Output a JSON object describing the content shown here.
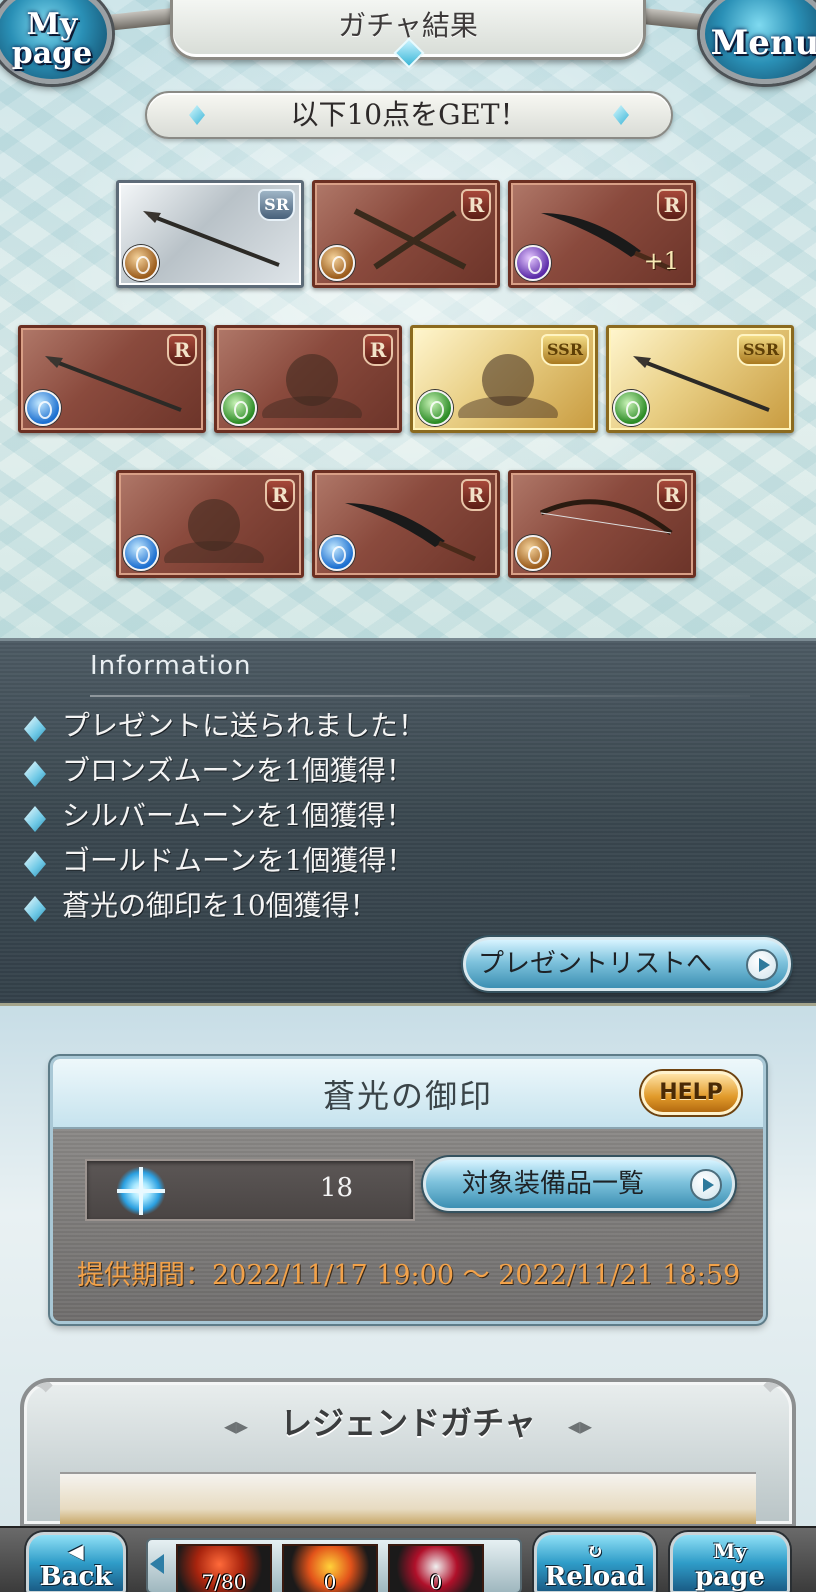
{
  "header": {
    "title": "ガチャ結果",
    "mypage_button": {
      "line1": "My",
      "line2": "page"
    },
    "menu_button": {
      "label": "Menu"
    }
  },
  "get_banner": "以下10点をGET！",
  "items": [
    {
      "rarity": "SR",
      "element": "earth",
      "art": "spear",
      "plus": ""
    },
    {
      "rarity": "R",
      "element": "earth",
      "art": "staves",
      "plus": ""
    },
    {
      "rarity": "R",
      "element": "dark",
      "art": "sword",
      "plus": "+1"
    },
    {
      "rarity": "R",
      "element": "water",
      "art": "spear",
      "plus": ""
    },
    {
      "rarity": "R",
      "element": "wind",
      "art": "character",
      "plus": ""
    },
    {
      "rarity": "SSR",
      "element": "wind",
      "art": "character",
      "plus": ""
    },
    {
      "rarity": "SSR",
      "element": "wind",
      "art": "spear",
      "plus": ""
    },
    {
      "rarity": "R",
      "element": "water",
      "art": "character",
      "plus": ""
    },
    {
      "rarity": "R",
      "element": "water",
      "art": "sword",
      "plus": ""
    },
    {
      "rarity": "R",
      "element": "earth",
      "art": "bow",
      "plus": ""
    }
  ],
  "info": {
    "title": "Information",
    "lines": [
      "プレゼントに送られました！",
      "ブロンズムーンを1個獲得！",
      "シルバームーンを1個獲得！",
      "ゴールドムーンを1個獲得！",
      "蒼光の御印を10個獲得！"
    ],
    "present_button": "プレゼントリストへ"
  },
  "seal": {
    "title": "蒼光の御印",
    "help": "HELP",
    "count": "18",
    "target_button": "対象装備品一覧",
    "period": "提供期間：2022/11/17 19:00 〜 2022/11/21 18:59"
  },
  "legend": {
    "title": "レジェンドガチャ",
    "arrow_left": "◂▸",
    "arrow_right": "◂▸"
  },
  "bottom_bar": {
    "back": {
      "line1": "◀",
      "line2": "Back"
    },
    "reload": {
      "line1": "↻",
      "line2": "Reload"
    },
    "mypage": {
      "line1": "My",
      "line2": "page"
    },
    "tray_items": [
      {
        "icon": "ticket-icon",
        "count": "7/80"
      },
      {
        "icon": "flame-icon",
        "count": "0"
      },
      {
        "icon": "mask-icon",
        "count": "0"
      }
    ]
  },
  "colors": {
    "period_text": "#f2a24a",
    "info_bg": "#3a474f",
    "accent_blue": "#2f9cc8"
  }
}
